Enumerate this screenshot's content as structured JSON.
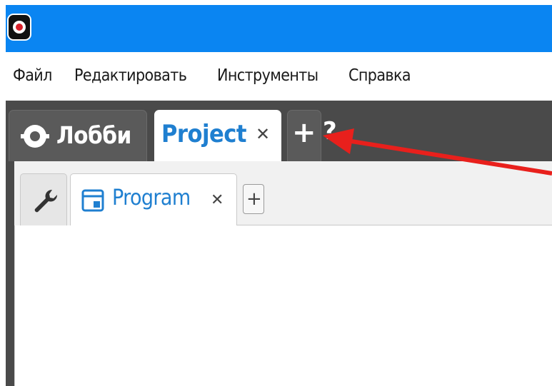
{
  "window": {
    "app_icon": "app-logo-icon",
    "accent_color": "#0a85f2"
  },
  "menu": {
    "items": [
      {
        "label": "Файл"
      },
      {
        "label": "Редактировать"
      },
      {
        "label": "Инструменты"
      },
      {
        "label": "Справка"
      }
    ]
  },
  "main_tabs": {
    "lobby": {
      "label": "Лобби",
      "icon": "lobby-icon"
    },
    "project": {
      "label": "Project",
      "close": "✕",
      "active": true
    },
    "add": {
      "glyph": "+"
    },
    "help": {
      "glyph": "?"
    }
  },
  "sub_tabs": {
    "tools": {
      "icon": "wrench-icon"
    },
    "program": {
      "label": "Program",
      "close": "✕",
      "icon": "program-window-icon",
      "active": true
    },
    "add": {
      "glyph": "+"
    }
  },
  "annotation": {
    "arrow_color": "#e8201c"
  }
}
